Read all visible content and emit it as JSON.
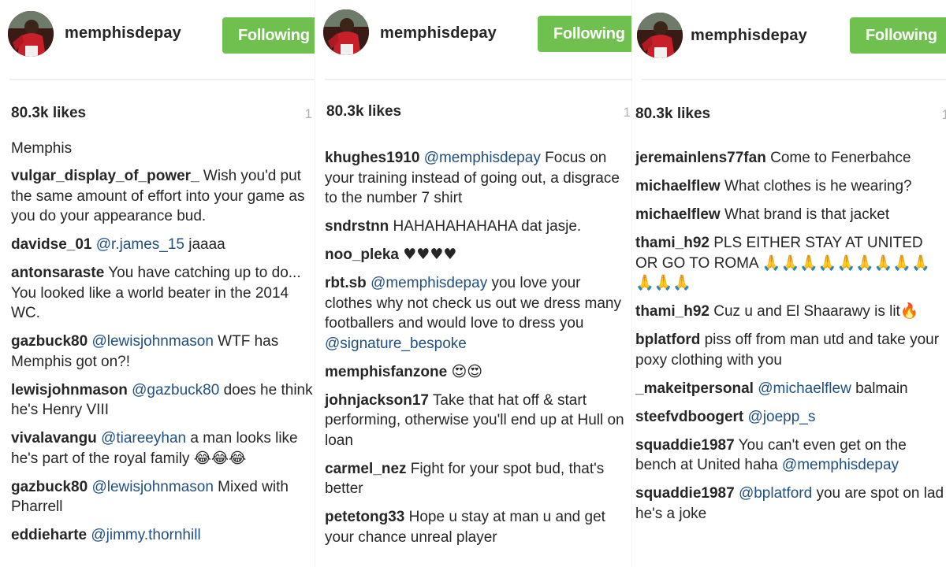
{
  "colors": {
    "follow_button": "#70c050",
    "mention": "#205080",
    "meta_text": "#b0b0b0"
  },
  "panels": [
    {
      "username": "memphisdepay",
      "follow_label": "Following",
      "likes": "80.3k likes",
      "time_fragment": "1",
      "caption": "Memphis",
      "comments": [
        {
          "user": "vulgar_display_of_power_",
          "parts": [
            {
              "t": "text",
              "v": " Wish you'd put the same amount of effort into your game as you do your appearance bud."
            }
          ]
        },
        {
          "user": "davidse_01",
          "parts": [
            {
              "t": "text",
              "v": " "
            },
            {
              "t": "mention",
              "v": "@r.james_15"
            },
            {
              "t": "text",
              "v": " jaaaa"
            }
          ]
        },
        {
          "user": "antonsaraste",
          "parts": [
            {
              "t": "text",
              "v": " You have catching up to do... You looked like a world beater in the 2014 WC."
            }
          ]
        },
        {
          "user": "gazbuck80",
          "parts": [
            {
              "t": "text",
              "v": " "
            },
            {
              "t": "mention",
              "v": "@lewisjohnmason"
            },
            {
              "t": "text",
              "v": " WTF has Memphis got on?!"
            }
          ]
        },
        {
          "user": "lewisjohnmason",
          "parts": [
            {
              "t": "text",
              "v": " "
            },
            {
              "t": "mention",
              "v": "@gazbuck80"
            },
            {
              "t": "text",
              "v": " does he think he's Henry VIII"
            }
          ]
        },
        {
          "user": "vivalavangu",
          "parts": [
            {
              "t": "text",
              "v": " "
            },
            {
              "t": "mention",
              "v": "@tiareeyhan"
            },
            {
              "t": "text",
              "v": " a man looks like he's part of the royal family "
            },
            {
              "t": "emoji",
              "v": "😂😂😂"
            }
          ]
        },
        {
          "user": "gazbuck80",
          "parts": [
            {
              "t": "text",
              "v": " "
            },
            {
              "t": "mention",
              "v": "@lewisjohnmason"
            },
            {
              "t": "text",
              "v": " Mixed with Pharrell"
            }
          ]
        },
        {
          "user": "eddieharte",
          "parts": [
            {
              "t": "text",
              "v": " "
            },
            {
              "t": "mention",
              "v": "@jimmy.thornhill"
            }
          ]
        }
      ]
    },
    {
      "username": "memphisdepay",
      "follow_label": "Following",
      "likes": "80.3k likes",
      "time_fragment": "1",
      "caption": "",
      "comments": [
        {
          "user": "khughes1910",
          "parts": [
            {
              "t": "text",
              "v": " "
            },
            {
              "t": "mention",
              "v": "@memphisdepay"
            },
            {
              "t": "text",
              "v": " Focus on your training instead of going out, a disgrace to the number 7 shirt"
            }
          ]
        },
        {
          "user": "sndrstnn",
          "parts": [
            {
              "t": "text",
              "v": " HAHAHAHAHAHA dat jasje."
            }
          ]
        },
        {
          "user": "noo_pleka",
          "parts": [
            {
              "t": "text",
              "v": " "
            },
            {
              "t": "emoji",
              "v": "♥♥♥♥"
            }
          ]
        },
        {
          "user": "rbt.sb",
          "parts": [
            {
              "t": "text",
              "v": " "
            },
            {
              "t": "mention",
              "v": "@memphisdepay"
            },
            {
              "t": "text",
              "v": " you love your clothes why not check us out we dress many footballers and would love to dress you "
            },
            {
              "t": "mention",
              "v": "@signature_bespoke"
            }
          ]
        },
        {
          "user": "memphisfanzone",
          "parts": [
            {
              "t": "text",
              "v": " "
            },
            {
              "t": "emoji",
              "v": "😍😍"
            }
          ]
        },
        {
          "user": "johnjackson17",
          "parts": [
            {
              "t": "text",
              "v": " Take that hat off & start performing, otherwise you'll end up at Hull on loan"
            }
          ]
        },
        {
          "user": "carmel_nez",
          "parts": [
            {
              "t": "text",
              "v": " Fight for your spot bud, that's better"
            }
          ]
        },
        {
          "user": "petetong33",
          "parts": [
            {
              "t": "text",
              "v": " Hope u stay at man u and get your chance unreal player"
            }
          ]
        }
      ]
    },
    {
      "username": "memphisdepay",
      "follow_label": "Following",
      "likes": "80.3k likes",
      "time_fragment": "1",
      "caption": "",
      "comments": [
        {
          "user": "jeremainlens77fan",
          "parts": [
            {
              "t": "text",
              "v": " Come to Fenerbahce"
            }
          ]
        },
        {
          "user": "michaelflew",
          "parts": [
            {
              "t": "text",
              "v": " What clothes is he wearing?"
            }
          ]
        },
        {
          "user": "michaelflew",
          "parts": [
            {
              "t": "text",
              "v": " What brand is that jacket"
            }
          ]
        },
        {
          "user": "thami_h92",
          "parts": [
            {
              "t": "text",
              "v": " PLS EITHER STAY AT UNITED OR GO TO ROMA "
            },
            {
              "t": "emoji",
              "v": "🙏🙏🙏🙏🙏🙏🙏🙏🙏🙏🙏🙏"
            }
          ]
        },
        {
          "user": "thami_h92",
          "parts": [
            {
              "t": "text",
              "v": " Cuz u and El Shaarawy is lit"
            },
            {
              "t": "emoji",
              "v": "🔥"
            }
          ]
        },
        {
          "user": "bplatford",
          "parts": [
            {
              "t": "text",
              "v": " piss off from man utd and take your poxy clothing with you"
            }
          ]
        },
        {
          "user": "_makeitpersonal",
          "parts": [
            {
              "t": "text",
              "v": " "
            },
            {
              "t": "mention",
              "v": "@michaelflew"
            },
            {
              "t": "text",
              "v": " balmain"
            }
          ]
        },
        {
          "user": "steefvdboogert",
          "parts": [
            {
              "t": "text",
              "v": " "
            },
            {
              "t": "mention",
              "v": "@joepp_s"
            }
          ]
        },
        {
          "user": "squaddie1987",
          "parts": [
            {
              "t": "text",
              "v": " You can't even get on the bench at United haha "
            },
            {
              "t": "mention",
              "v": "@memphisdepay"
            }
          ]
        },
        {
          "user": "squaddie1987",
          "parts": [
            {
              "t": "text",
              "v": " "
            },
            {
              "t": "mention",
              "v": "@bplatford"
            },
            {
              "t": "text",
              "v": " you are spot on lad he's a joke"
            }
          ]
        }
      ]
    }
  ]
}
